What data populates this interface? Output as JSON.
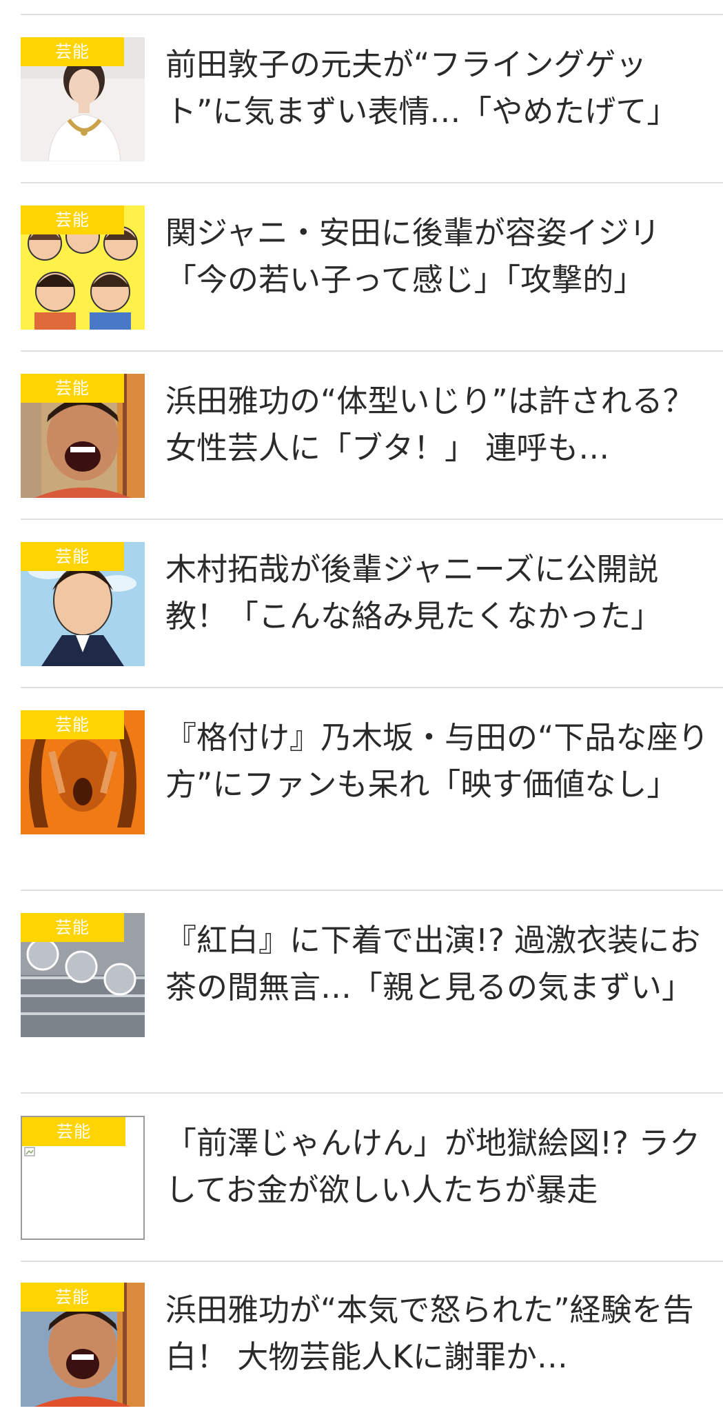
{
  "articles": [
    {
      "category": "芸能",
      "title": "前田敦子の元夫が“フライングゲット”に気まずい表情…「やめたげて」",
      "thumbnail": "woman-photo"
    },
    {
      "category": "芸能",
      "title": "関ジャニ・安田に後輩が容姿イジリ「今の若い子って感じ」「攻撃的」",
      "thumbnail": "group-illustration"
    },
    {
      "category": "芸能",
      "title": "浜田雅功の“体型いじり”は許される？女性芸人に「ブタ！」 連呼も…",
      "thumbnail": "laughing-man-photo"
    },
    {
      "category": "芸能",
      "title": "木村拓哉が後輩ジャニーズに公開説教！「こんな絡み見たくなかった」",
      "thumbnail": "man-illustration"
    },
    {
      "category": "芸能",
      "title": "『格付け』乃木坂・与田の“下品な座り方”にファンも呆れ「映す価値なし」",
      "thumbnail": "screaming-woman-orange"
    },
    {
      "category": "芸能",
      "title": "『紅白』に下着で出演!? 過激衣装にお茶の間無言…「親と見るの気まずい」",
      "thumbnail": "nhk-building"
    },
    {
      "category": "芸能",
      "title": "「前澤じゃんけん」が地獄絵図!? ラクしてお金が欲しい人たちが暴走",
      "thumbnail": "broken-image"
    },
    {
      "category": "芸能",
      "title": "浜田雅功が“本気で怒られた”経験を告白！ 大物芸能人Kに謝罪か…",
      "thumbnail": "laughing-man-photo"
    }
  ],
  "colors": {
    "badge": "#ffd400",
    "divider": "#e0e0e0",
    "text": "#2a2a2a"
  }
}
